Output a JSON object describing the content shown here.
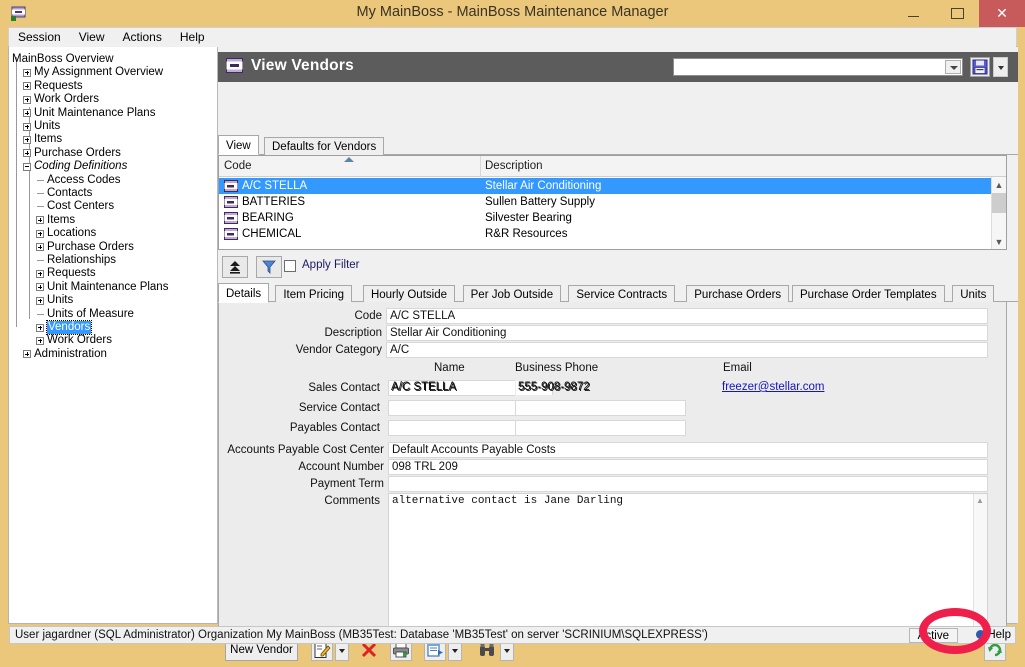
{
  "window": {
    "title": "My MainBoss - MainBoss Maintenance Manager",
    "app_icon": "mainboss-icon",
    "minimize_label": "Minimize",
    "maximize_label": "Maximize",
    "close_label": "✕"
  },
  "menubar": {
    "items": [
      {
        "label": "Session"
      },
      {
        "label": "View"
      },
      {
        "label": "Actions"
      },
      {
        "label": "Help"
      }
    ]
  },
  "sidebar": {
    "items": [
      {
        "label": "MainBoss Overview",
        "indent": 0,
        "toggle": "none",
        "selected": false,
        "italic": false
      },
      {
        "label": "My Assignment Overview",
        "indent": 1,
        "toggle": "plus",
        "selected": false,
        "italic": false
      },
      {
        "label": "Requests",
        "indent": 1,
        "toggle": "plus",
        "selected": false,
        "italic": false
      },
      {
        "label": "Work Orders",
        "indent": 1,
        "toggle": "plus",
        "selected": false,
        "italic": false
      },
      {
        "label": "Unit Maintenance Plans",
        "indent": 1,
        "toggle": "plus",
        "selected": false,
        "italic": false
      },
      {
        "label": "Units",
        "indent": 1,
        "toggle": "plus",
        "selected": false,
        "italic": false
      },
      {
        "label": "Items",
        "indent": 1,
        "toggle": "plus",
        "selected": false,
        "italic": false
      },
      {
        "label": "Purchase Orders",
        "indent": 1,
        "toggle": "plus",
        "selected": false,
        "italic": false
      },
      {
        "label": "Coding Definitions",
        "indent": 1,
        "toggle": "minus",
        "selected": false,
        "italic": true
      },
      {
        "label": "Access Codes",
        "indent": 2,
        "toggle": "leaf",
        "selected": false,
        "italic": false
      },
      {
        "label": "Contacts",
        "indent": 2,
        "toggle": "leaf",
        "selected": false,
        "italic": false
      },
      {
        "label": "Cost Centers",
        "indent": 2,
        "toggle": "leaf",
        "selected": false,
        "italic": false
      },
      {
        "label": "Items",
        "indent": 2,
        "toggle": "plus",
        "selected": false,
        "italic": false
      },
      {
        "label": "Locations",
        "indent": 2,
        "toggle": "plus",
        "selected": false,
        "italic": false
      },
      {
        "label": "Purchase Orders",
        "indent": 2,
        "toggle": "plus",
        "selected": false,
        "italic": false
      },
      {
        "label": "Relationships",
        "indent": 2,
        "toggle": "leaf",
        "selected": false,
        "italic": false
      },
      {
        "label": "Requests",
        "indent": 2,
        "toggle": "plus",
        "selected": false,
        "italic": false
      },
      {
        "label": "Unit Maintenance Plans",
        "indent": 2,
        "toggle": "plus",
        "selected": false,
        "italic": false
      },
      {
        "label": "Units",
        "indent": 2,
        "toggle": "plus",
        "selected": false,
        "italic": false
      },
      {
        "label": "Units of Measure",
        "indent": 2,
        "toggle": "leaf",
        "selected": false,
        "italic": false
      },
      {
        "label": "Vendors",
        "indent": 2,
        "toggle": "plus",
        "selected": true,
        "italic": false
      },
      {
        "label": "Work Orders",
        "indent": 2,
        "toggle": "plus",
        "selected": false,
        "italic": false
      },
      {
        "label": "Administration",
        "indent": 1,
        "toggle": "plus",
        "selected": false,
        "italic": false
      }
    ]
  },
  "pane": {
    "header": {
      "title": "View Vendors",
      "icon": "vendor-icon",
      "combo_value": "",
      "save_icon": "save-icon",
      "dropdown_icon": "chevron-down-icon"
    },
    "top_tabs": [
      {
        "label": "View",
        "active": true
      },
      {
        "label": "Defaults for Vendors",
        "active": false
      }
    ],
    "grid": {
      "columns": [
        "Code",
        "Description"
      ],
      "sort_column": "Code",
      "sort_direction": "ascending",
      "rows": [
        {
          "code": "A/C STELLA",
          "description": "Stellar Air Conditioning",
          "selected": true
        },
        {
          "code": "BATTERIES",
          "description": "Sullen Battery Supply",
          "selected": false
        },
        {
          "code": "BEARING",
          "description": "Silvester Bearing",
          "selected": false
        },
        {
          "code": "CHEMICAL",
          "description": "R&R Resources",
          "selected": false
        }
      ]
    },
    "filterbar": {
      "restore_icon": "collapse-up-icon",
      "filter_icon": "funnel-icon",
      "apply_filter_label": "Apply Filter",
      "apply_filter_checked": false
    },
    "detail_tabs": [
      {
        "label": "Details",
        "active": true
      },
      {
        "label": "Item Pricing",
        "active": false
      },
      {
        "label": "Hourly Outside",
        "active": false
      },
      {
        "label": "Per Job Outside",
        "active": false
      },
      {
        "label": "Service Contracts",
        "active": false
      },
      {
        "label": "Purchase Orders",
        "active": false
      },
      {
        "label": "Purchase Order Templates",
        "active": false
      },
      {
        "label": "Units",
        "active": false
      }
    ],
    "details": {
      "code_label": "Code",
      "code_value": "A/C STELLA",
      "description_label": "Description",
      "description_value": "Stellar Air Conditioning",
      "vendor_category_label": "Vendor Category",
      "vendor_category_value": "A/C",
      "contact_columns": {
        "name": "Name",
        "business_phone": "Business Phone",
        "email": "Email"
      },
      "contacts": [
        {
          "label": "Sales Contact",
          "name": "A/C STELLA",
          "phone": "555-908-9872",
          "email": "freezer@stellar.com"
        },
        {
          "label": "Service Contact",
          "name": "",
          "phone": "",
          "email": ""
        },
        {
          "label": "Payables Contact",
          "name": "",
          "phone": "",
          "email": ""
        }
      ],
      "ap_cost_center_label": "Accounts Payable Cost Center",
      "ap_cost_center_value": "Default Accounts Payable Costs",
      "account_number_label": "Account Number",
      "account_number_value": "098 TRL 209",
      "payment_term_label": "Payment Term",
      "payment_term_value": "",
      "comments_label": "Comments",
      "comments_value": "alternative contact is Jane Darling"
    },
    "bottom_toolbar": {
      "new_vendor_label": "New Vendor",
      "edit_icon": "edit-icon",
      "edit_dropdown_icon": "chevron-down-icon",
      "delete_icon": "delete-x-icon",
      "print_icon": "print-icon",
      "report_icon": "report-icon",
      "report_dropdown_icon": "chevron-down-icon",
      "find_icon": "binoculars-icon",
      "find_dropdown_icon": "chevron-down-icon",
      "refresh_icon": "refresh-icon"
    }
  },
  "statusbar": {
    "text": "User jagardner (SQL Administrator) Organization My MainBoss (MB35Test: Database 'MB35Test' on server 'SCRINIUM\\SQLEXPRESS')",
    "active_label": "Active",
    "help_label": "Help"
  },
  "annotation": {
    "highlight_shape": "red-ellipse",
    "highlight_color": "#ee1f4b",
    "highlight_target": "Active"
  },
  "colors": {
    "titlebar": "#eac77a",
    "header": "#5c5c5c",
    "selection": "#3399ff",
    "close_button": "#c75b5b",
    "link": "#1414c8"
  }
}
